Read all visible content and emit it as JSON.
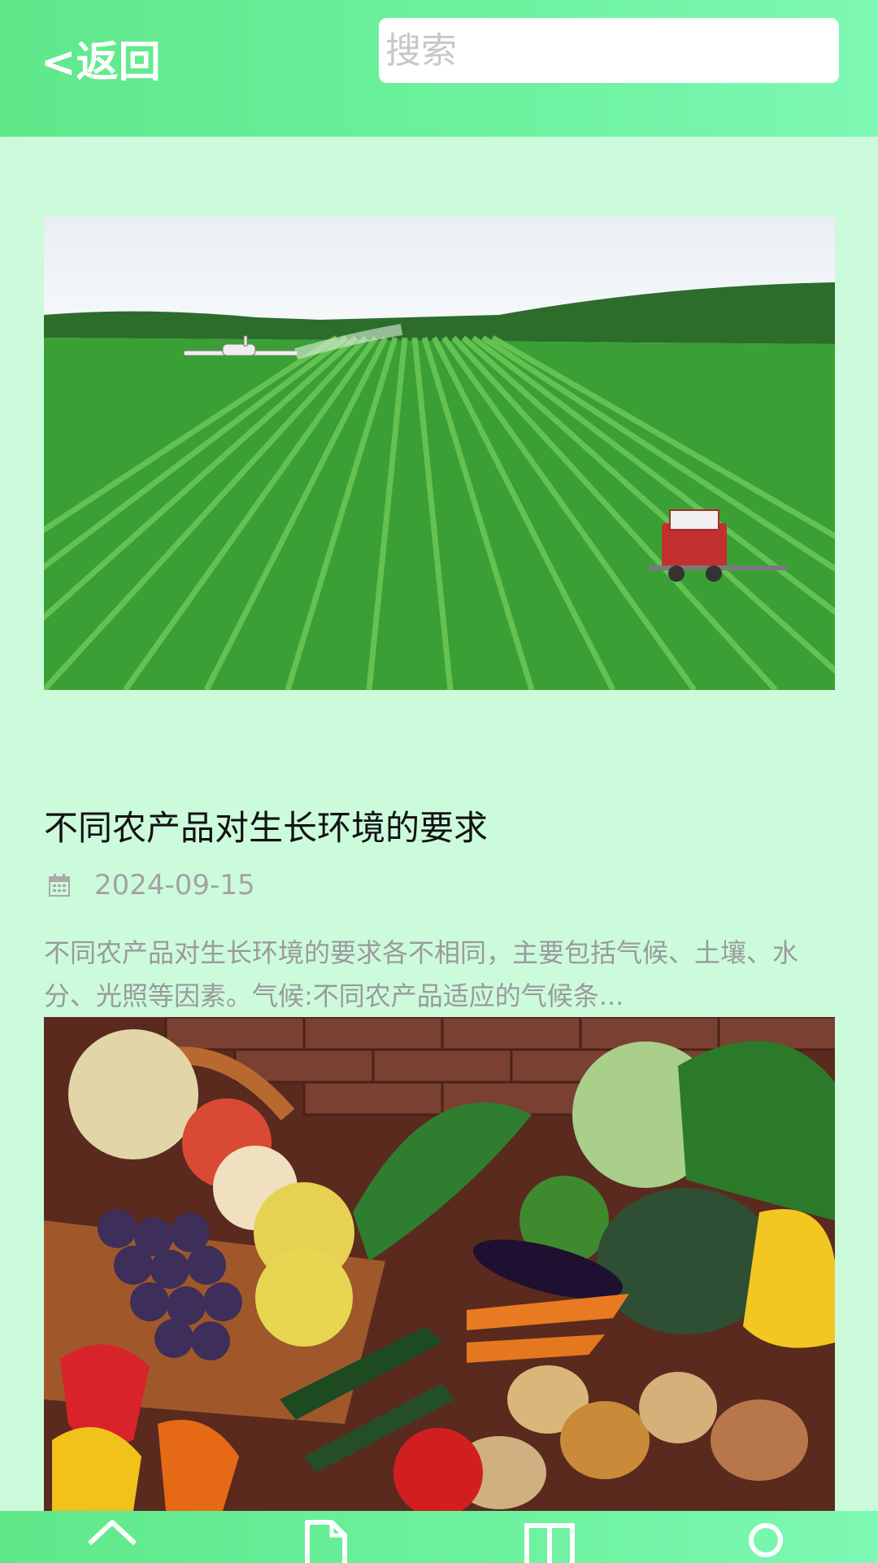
{
  "header": {
    "back_label": "<返回",
    "search_placeholder": "搜索"
  },
  "articles": [
    {
      "title": "不同农产品对生长环境的要求",
      "date": "2024-09-15",
      "summary": "不同农产品对生长环境的要求各不相同，主要包括气候、土壤、水分、光照等因素。气候:不同农产品适应的气候条...",
      "image": "farmland-photo"
    },
    {
      "title": "",
      "image": "produce-basket-photo"
    }
  ],
  "bottom_nav": {
    "items": [
      {
        "icon": "home-icon"
      },
      {
        "icon": "document-icon"
      },
      {
        "icon": "book-icon"
      },
      {
        "icon": "user-icon"
      }
    ]
  },
  "colors": {
    "header_green": "#5fe88a",
    "page_background": "#ccfbdc",
    "title_text": "#111111",
    "muted_text": "#9a9a9a"
  }
}
